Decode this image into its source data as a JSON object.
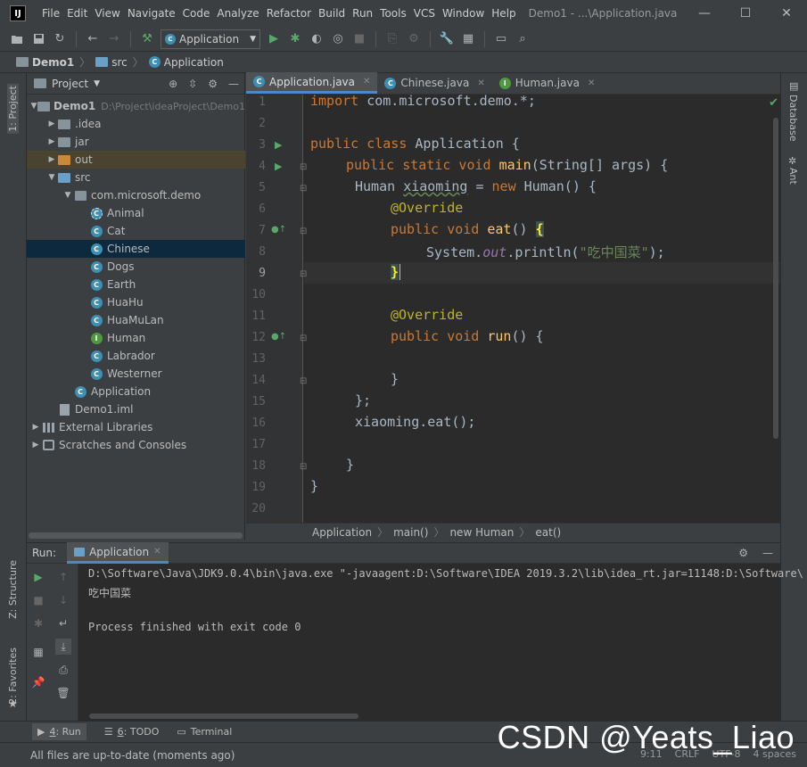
{
  "window": {
    "app_logo": "IJ",
    "title": "Demo1 - ...\\Application.java",
    "menus": [
      "File",
      "Edit",
      "View",
      "Navigate",
      "Code",
      "Analyze",
      "Refactor",
      "Build",
      "Run",
      "Tools",
      "VCS",
      "Window",
      "Help"
    ],
    "controls": {
      "minimize": "—",
      "maximize": "☐",
      "close": "✕"
    }
  },
  "toolbar": {
    "run_config": "Application"
  },
  "navbar": {
    "crumbs": [
      "Demo1",
      "src",
      "Application"
    ]
  },
  "left_strip": {
    "project_tab": "1: Project",
    "structure_tab": "Z: Structure",
    "favorites_tab": "2: Favorites"
  },
  "right_strip": {
    "database_tab": "Database",
    "ant_tab": "Ant"
  },
  "project": {
    "title": "Project",
    "tree": [
      {
        "label": "Demo1",
        "hint": "D:\\Project\\ideaProject\\Demo1",
        "level": 0,
        "arrow": "▼",
        "icon": "folder-icon"
      },
      {
        "label": ".idea",
        "level": 1,
        "arrow": "▶",
        "icon": "folder-icon"
      },
      {
        "label": "jar",
        "level": 1,
        "arrow": "▶",
        "icon": "folder-icon"
      },
      {
        "label": "out",
        "level": 1,
        "arrow": "▶",
        "icon": "folder-orange-icon"
      },
      {
        "label": "src",
        "level": 1,
        "arrow": "▼",
        "icon": "folder-blue-icon"
      },
      {
        "label": "com.microsoft.demo",
        "level": 2,
        "arrow": "▼",
        "icon": "package-icon"
      },
      {
        "label": "Animal",
        "level": 3,
        "icon": "abstract-class-icon"
      },
      {
        "label": "Cat",
        "level": 3,
        "icon": "class-icon"
      },
      {
        "label": "Chinese",
        "level": 3,
        "icon": "class-icon"
      },
      {
        "label": "Dogs",
        "level": 3,
        "icon": "class-icon"
      },
      {
        "label": "Earth",
        "level": 3,
        "icon": "class-icon"
      },
      {
        "label": "HuaHu",
        "level": 3,
        "icon": "class-icon"
      },
      {
        "label": "HuaMuLan",
        "level": 3,
        "icon": "class-icon"
      },
      {
        "label": "Human",
        "level": 3,
        "icon": "interface-icon"
      },
      {
        "label": "Labrador",
        "level": 3,
        "icon": "class-icon"
      },
      {
        "label": "Westerner",
        "level": 3,
        "icon": "class-icon"
      },
      {
        "label": "Application",
        "level": 2,
        "icon": "class-icon"
      },
      {
        "label": "Demo1.iml",
        "level": 1,
        "icon": "file-icon"
      },
      {
        "label": "External Libraries",
        "level": 0,
        "arrow": "▶",
        "icon": "library-icon"
      },
      {
        "label": "Scratches and Consoles",
        "level": 0,
        "arrow": "▶",
        "icon": "scratch-icon"
      }
    ]
  },
  "editor": {
    "tabs": [
      {
        "label": "Application.java",
        "icon": "C"
      },
      {
        "label": "Chinese.java",
        "icon": "C"
      },
      {
        "label": "Human.java",
        "icon": "I"
      }
    ],
    "line_numbers": [
      "1",
      "2",
      "3",
      "4",
      "5",
      "6",
      "7",
      "8",
      "9",
      "10",
      "11",
      "12",
      "13",
      "14",
      "15",
      "16",
      "17",
      "18",
      "19",
      "20"
    ],
    "code": {
      "l1_kw": "import ",
      "l1_rest": "com.microsoft.demo.*;",
      "l3_kw": "public class ",
      "l3_rest": "Application {",
      "l4_kw": "public static void ",
      "l4_fn": "main",
      "l4_rest": "(String[] args) {",
      "l5_a": "Human ",
      "l5_b": "xiaoming",
      "l5_c": " = ",
      "l5_kw": "new ",
      "l5_d": "Human() {",
      "l6_ann": "@Override",
      "l7_kw": "public void ",
      "l7_fn": "eat",
      "l7_rest": "() ",
      "l7_brace": "{",
      "l8_a": "System.",
      "l8_it": "out",
      "l8_b": ".println(",
      "l8_str": "\"吃中国菜\"",
      "l8_c": ");",
      "l9_brace": "}",
      "l11_ann": "@Override",
      "l12_kw": "public void ",
      "l12_fn": "run",
      "l12_rest": "() {",
      "l14": "}",
      "l15": "};",
      "l16": "xiaoming.eat();",
      "l18": "}",
      "l19": "}"
    },
    "breadcrumbs": [
      "Application",
      "main()",
      "new Human",
      "eat()"
    ]
  },
  "run": {
    "label": "Run:",
    "tab": "Application",
    "console": [
      "D:\\Software\\Java\\JDK9.0.4\\bin\\java.exe \"-javaagent:D:\\Software\\IDEA 2019.3.2\\lib\\idea_rt.jar=11148:D:\\Software\\",
      "吃中国菜",
      "",
      "Process finished with exit code 0"
    ]
  },
  "bottom_tabs": {
    "run_num": "4",
    "run_label": ": Run",
    "todo_num": "6",
    "todo_label": ": TODO",
    "terminal": "Terminal"
  },
  "status": {
    "message": "All files are up-to-date (moments ago)",
    "right": [
      "9:11",
      "CRLF",
      "UTF-8",
      "4 spaces"
    ]
  },
  "watermark": "CSDN @Yeats_Liao"
}
